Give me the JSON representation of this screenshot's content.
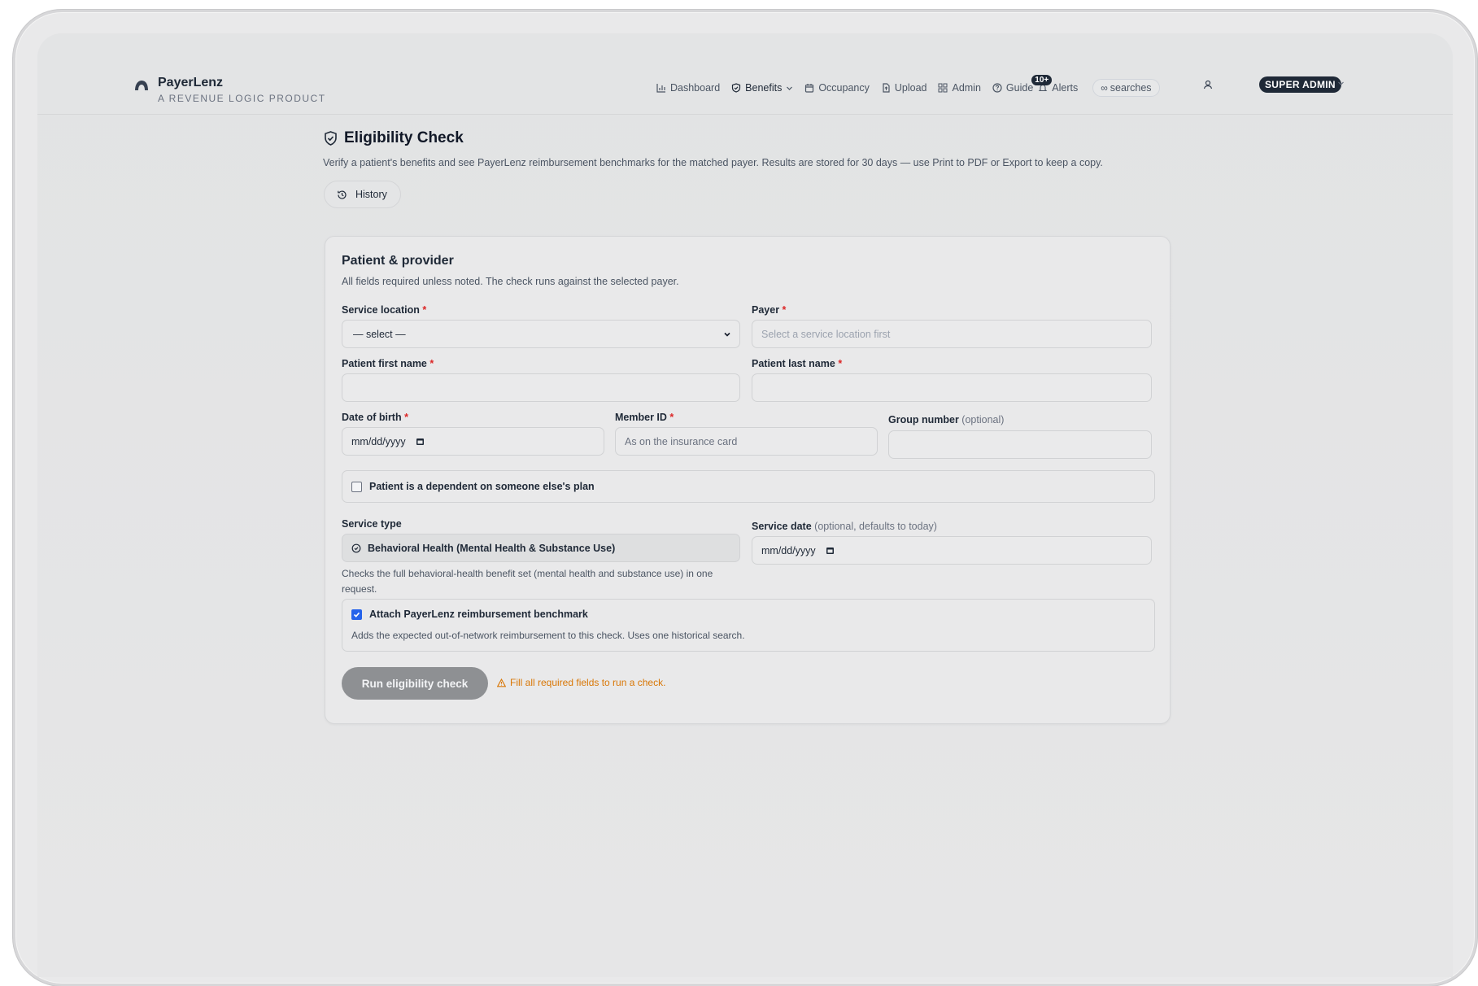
{
  "brand": {
    "name": "PayerLenz",
    "tagline": "A REVENUE LOGIC PRODUCT"
  },
  "nav": {
    "items": [
      {
        "label": "Dashboard",
        "icon": "bar-chart-icon"
      },
      {
        "label": "Benefits",
        "icon": "shield-check-icon"
      },
      {
        "label": "Occupancy",
        "icon": "calendar-icon"
      },
      {
        "label": "Upload",
        "icon": "file-upload-icon"
      },
      {
        "label": "Admin",
        "icon": "grid-icon"
      },
      {
        "label": "Guide",
        "icon": "help-circle-icon"
      },
      {
        "label": "Alerts",
        "icon": "bell-icon",
        "badge": "10+"
      }
    ],
    "searches_label": "searches",
    "searches_icon": "infinity-icon",
    "role_label": "SUPER ADMIN"
  },
  "page": {
    "title": "Eligibility Check",
    "description": "Verify a patient's benefits and see PayerLenz reimbursement benchmarks for the matched payer. Results are stored for 30 days — use Print to PDF or Export to keep a copy.",
    "history_label": "History"
  },
  "form": {
    "title": "Patient & provider",
    "subtitle": "All fields required unless noted. The check runs against the selected payer.",
    "service_location": {
      "label": "Service location",
      "value": "— select —"
    },
    "payer": {
      "label": "Payer",
      "placeholder": "Select a service location first"
    },
    "first_name": {
      "label": "Patient first name",
      "value": ""
    },
    "last_name": {
      "label": "Patient last name",
      "value": ""
    },
    "dob": {
      "label": "Date of birth",
      "value": "mm/dd/yyyy"
    },
    "member_id": {
      "label": "Member ID",
      "placeholder": "As on the insurance card"
    },
    "group_number": {
      "label": "Group number",
      "optional": "(optional)",
      "value": ""
    },
    "dependent": {
      "label": "Patient is a dependent on someone else's plan",
      "checked": false
    },
    "service_type": {
      "label": "Service type",
      "value": "Behavioral Health (Mental Health & Substance Use)",
      "helper_line1": "Checks the full behavioral-health benefit set (mental health and substance use) in one",
      "helper_line2": "request."
    },
    "service_date": {
      "label": "Service date",
      "optional": "(optional, defaults to today)",
      "value": "mm/dd/yyyy"
    },
    "benchmark": {
      "label": "Attach PayerLenz reimbursement benchmark",
      "checked": true,
      "helper": "Adds the expected out-of-network reimbursement to this check. Uses one historical search."
    },
    "run_label": "Run eligibility check",
    "warning": "Fill all required fields to run a check."
  },
  "colors": {
    "required": "#dc2626",
    "warning": "#d97706",
    "checkbox_accent": "#2563eb",
    "dark_pill": "#1f2937"
  }
}
